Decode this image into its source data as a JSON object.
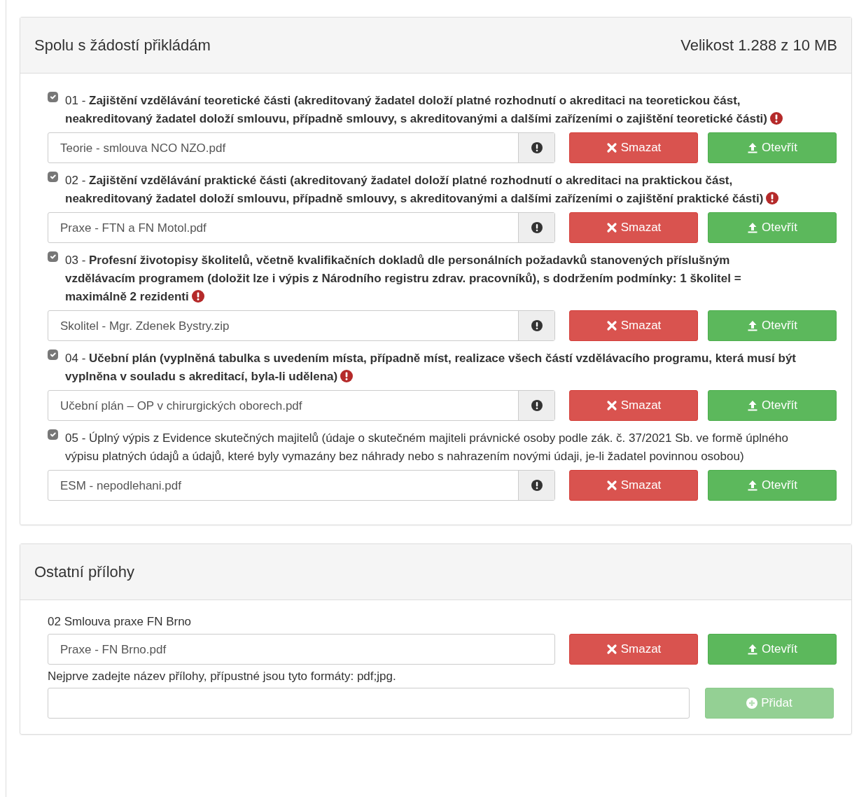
{
  "panels": [
    {
      "title": "Spolu s žádostí přikládám",
      "size_info": "Velikost 1.288 z 10 MB",
      "kind": "required_list",
      "items": [
        {
          "number": "01 -",
          "text": "Zajištění vzdělávání teoretické části (akreditovaný žadatel doloží platné rozhodnutí o akreditaci na teoretickou část, neakreditovaný žadatel doloží smlouvu, případně smlouvy, s akreditovanými a dalšími zařízeními o zajištění teoretické části)",
          "checked": true,
          "required": true,
          "file": "Teorie - smlouva NCO NZO.pdf",
          "delete": "Smazat",
          "open": "Otevřít"
        },
        {
          "number": "02 -",
          "text": "Zajištění vzdělávání praktické části (akreditovaný žadatel doloží platné rozhodnutí o akreditaci na praktickou část, neakreditovaný žadatel doloží smlouvu, případně smlouvy, s akreditovanými a dalšími zařízeními o zajištění praktické části)",
          "checked": true,
          "required": true,
          "file": "Praxe - FTN a FN Motol.pdf",
          "delete": "Smazat",
          "open": "Otevřít"
        },
        {
          "number": "03 -",
          "text": "Profesní životopisy školitelů, včetně kvalifikačních dokladů dle personálních požadavků stanovených příslušným vzdělávacím programem (doložit lze i výpis z Národního registru zdrav. pracovníků), s dodržením podmínky: 1 školitel = maximálně 2 rezidenti",
          "checked": true,
          "required": true,
          "file": "Skolitel - Mgr. Zdenek Bystry.zip",
          "delete": "Smazat",
          "open": "Otevřít"
        },
        {
          "number": "04 -",
          "text": "Učební plán (vyplněná tabulka s uvedením místa, případně míst, realizace všech částí vzdělávacího programu, která musí být vyplněna v souladu s akreditací, byla-li udělena)",
          "checked": true,
          "required": true,
          "file": "Učební plán – OP v chirurgických oborech.pdf",
          "delete": "Smazat",
          "open": "Otevřít"
        },
        {
          "number": "05 -",
          "text": "Úplný výpis z Evidence skutečných majitelů (údaje o skutečném majiteli právnické osoby podle zák. č. 37/2021 Sb. ve formě úplného výpisu platných údajů a údajů, které byly vymazány bez náhrady nebo s nahrazením novými údaji, je-li žadatel povinnou osobou)",
          "checked": true,
          "required": false,
          "file": "ESM - nepodlehani.pdf",
          "delete": "Smazat",
          "open": "Otevřít"
        }
      ]
    },
    {
      "title": "Ostatní přílohy",
      "kind": "other_list",
      "items": [
        {
          "label": "02 Smlouva praxe FN Brno",
          "file": "Praxe - FN Brno.pdf",
          "delete": "Smazat",
          "open": "Otevřít"
        }
      ],
      "hint": "Nejprve zadejte název přílohy, přípustné jsou tyto formáty: pdf;jpg.",
      "add_button": {
        "label": "Přidat",
        "disabled": true
      }
    }
  ]
}
